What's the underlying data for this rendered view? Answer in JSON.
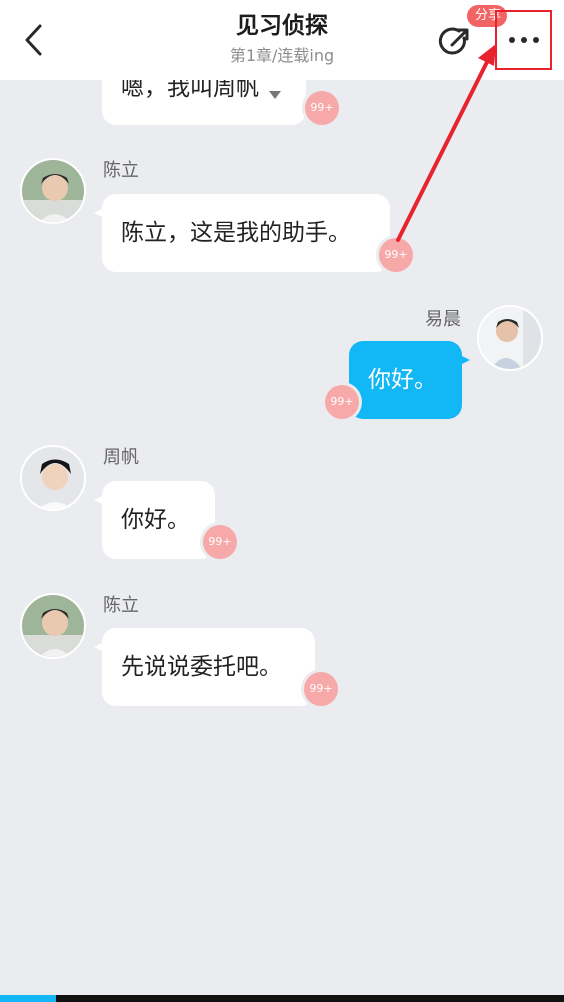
{
  "header": {
    "title": "见习侦探",
    "subtitle": "第1章/连载ing",
    "share_badge": "分享",
    "back_icon": "chevron-left-icon",
    "share_icon": "share-icon",
    "more_icon": "more-dots-icon"
  },
  "messages": [
    {
      "sender": "",
      "text": "嗯，我叫周帆",
      "badge": "99+",
      "side": "left",
      "partial": true
    },
    {
      "sender": "陈立",
      "text": "陈立，这是我的助手。",
      "badge": "99+",
      "side": "left"
    },
    {
      "sender": "易晨",
      "text": "你好。",
      "badge": "99+",
      "side": "right"
    },
    {
      "sender": "周帆",
      "text": "你好。",
      "badge": "99+",
      "side": "left"
    },
    {
      "sender": "陈立",
      "text": "先说说委托吧。",
      "badge": "99+",
      "side": "left"
    }
  ],
  "colors": {
    "accent": "#12b7f5",
    "badge": "#f7a8a8",
    "share_badge": "#f46363",
    "annotation": "#e8232f",
    "background": "#ebecf0"
  },
  "reading_progress": 0.1
}
